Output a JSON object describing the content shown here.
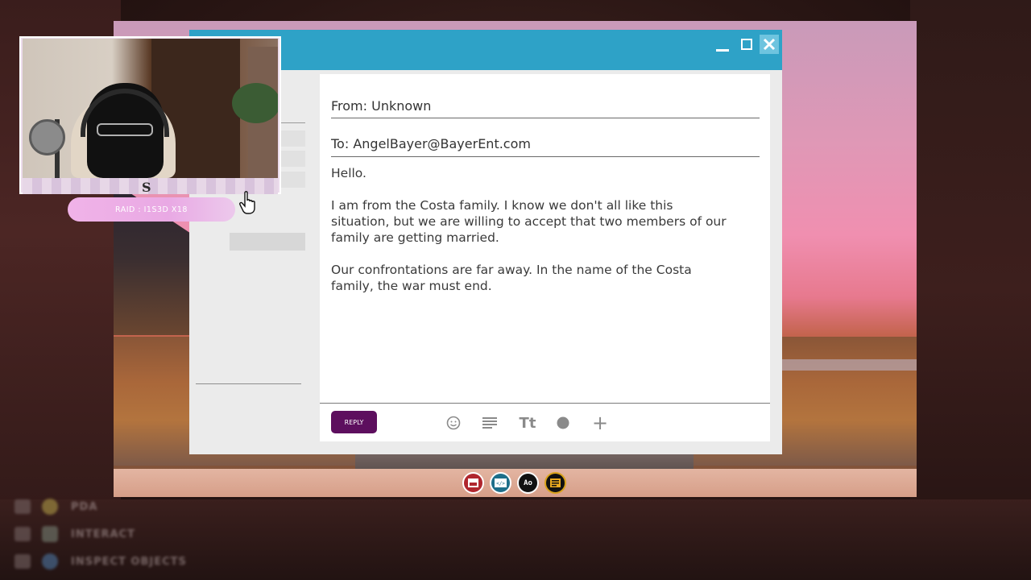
{
  "mail": {
    "from": "From: Unknown",
    "to": "To: AngelBayer@BayerEnt.com",
    "greeting": "Hello.",
    "paragraph1": "I am from the Costa family. I know we don't all like this situation, but we are willing to accept that two members of our family are getting married.",
    "paragraph2": "Our confrontations are far away. In the name of the Costa family, the war must end.",
    "reply_label": "REPLY"
  },
  "toolbar": {
    "icons": [
      "emoji-icon",
      "align-icon",
      "text-size-icon",
      "record-icon",
      "add-icon"
    ],
    "text_size_glyph": "Tt",
    "add_glyph": "+"
  },
  "window": {
    "title_color": "#2ea2c7",
    "reply_color": "#5d0f5e"
  },
  "dock": {
    "apps": [
      "mail-app-icon",
      "code-app-icon",
      "font-app-icon",
      "terminal-app-icon"
    ],
    "font_app_glyph": "Ao"
  },
  "stream": {
    "raid_text": "RAID : I1S3D X18",
    "logo": "S"
  },
  "controls": {
    "hints": [
      "PDA",
      "INTERACT",
      "INSPECT OBJECTS"
    ]
  }
}
